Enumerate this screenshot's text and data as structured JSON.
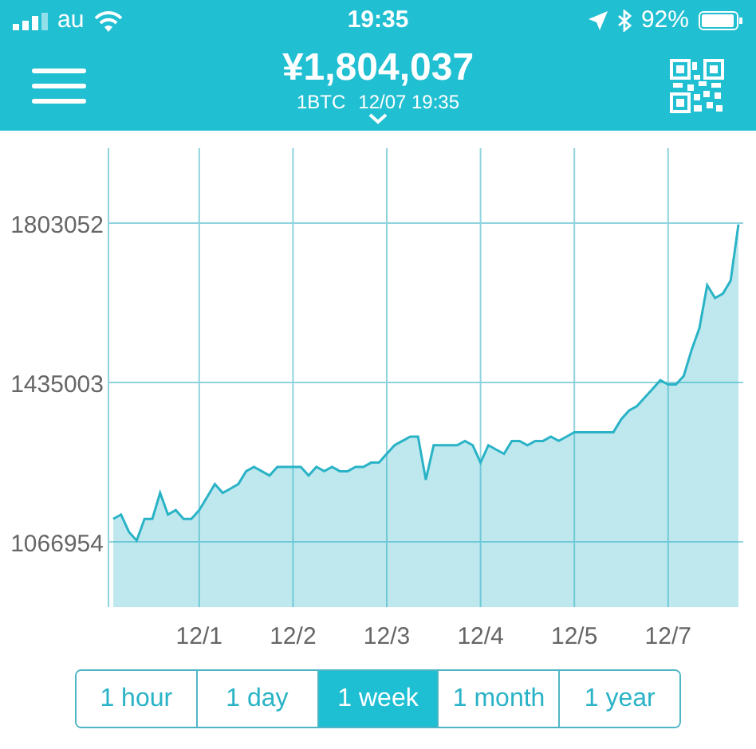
{
  "status_bar": {
    "carrier": "au",
    "time": "19:35",
    "battery": "92%"
  },
  "header": {
    "price": "¥1,804,037",
    "unit": "1BTC",
    "timestamp": "12/07 19:35"
  },
  "chart": {
    "chart_data": {
      "type": "area",
      "categories": [
        null,
        null,
        null,
        null,
        null,
        null,
        null,
        null,
        null,
        null,
        null,
        "12/1",
        null,
        null,
        null,
        null,
        null,
        null,
        null,
        null,
        null,
        null,
        null,
        "12/2",
        null,
        null,
        null,
        null,
        null,
        null,
        null,
        null,
        null,
        null,
        null,
        "12/3",
        null,
        null,
        null,
        null,
        null,
        null,
        null,
        null,
        null,
        null,
        null,
        "12/4",
        null,
        null,
        null,
        null,
        null,
        null,
        null,
        null,
        null,
        null,
        null,
        "12/5",
        null,
        null,
        null,
        null,
        null,
        null,
        null,
        null,
        null,
        null,
        null,
        "12/7",
        null,
        null,
        null,
        null,
        null,
        null,
        null,
        null,
        null
      ],
      "series": [
        {
          "color": "#2ab3c6",
          "values": [
            1120000,
            1130000,
            1090000,
            1070000,
            1120000,
            1120000,
            1180000,
            1130000,
            1140000,
            1120000,
            1120000,
            1140000,
            1170000,
            1200000,
            1180000,
            1190000,
            1200000,
            1230000,
            1240000,
            1230000,
            1220000,
            1240000,
            1240000,
            1240000,
            1240000,
            1220000,
            1240000,
            1230000,
            1240000,
            1230000,
            1230000,
            1240000,
            1240000,
            1250000,
            1250000,
            1270000,
            1290000,
            1300000,
            1310000,
            1310000,
            1210000,
            1290000,
            1290000,
            1290000,
            1290000,
            1300000,
            1290000,
            1250000,
            1290000,
            1280000,
            1270000,
            1300000,
            1300000,
            1290000,
            1300000,
            1300000,
            1310000,
            1300000,
            1310000,
            1320000,
            1320000,
            1320000,
            1320000,
            1320000,
            1320000,
            1350000,
            1370000,
            1380000,
            1400000,
            1420000,
            1440000,
            1430000,
            1430000,
            1450000,
            1510000,
            1560000,
            1660000,
            1630000,
            1640000,
            1670000,
            1800000
          ]
        }
      ],
      "ylim": [
        916000,
        1976000
      ],
      "grid": true,
      "yticks": [
        1066954,
        1435003,
        1803052
      ]
    }
  },
  "range_tabs": [
    {
      "label": "1 hour",
      "selected": false
    },
    {
      "label": "1 day",
      "selected": false
    },
    {
      "label": "1 week",
      "selected": true
    },
    {
      "label": "1 month",
      "selected": false
    },
    {
      "label": "1 year",
      "selected": false
    }
  ]
}
